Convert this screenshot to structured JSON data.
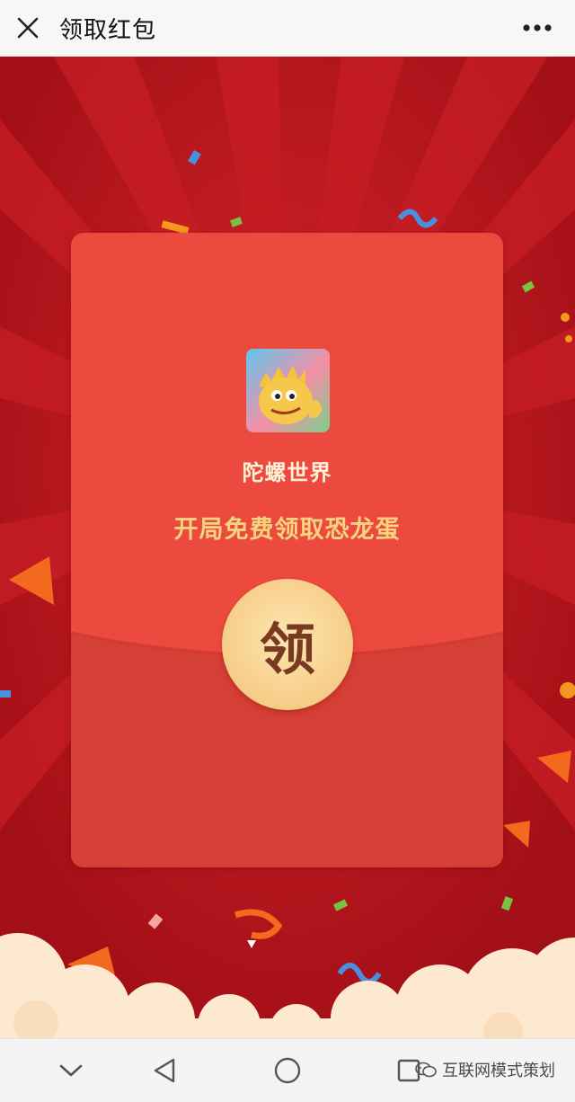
{
  "header": {
    "title": "领取红包",
    "close_icon": "close-icon",
    "more_icon": "more-dots-icon"
  },
  "envelope": {
    "app_name": "陀螺世界",
    "promo_text": "开局免费领取恐龙蛋",
    "claim_label": "领",
    "logo_icon": "dinosaur-logo-icon"
  },
  "nav": {
    "items": [
      "chevron-down-icon",
      "back-triangle-icon",
      "home-circle-icon",
      "recents-square-icon"
    ]
  },
  "watermark": {
    "text": "互联网模式策划",
    "icon": "wechat-channel-icon"
  },
  "colors": {
    "background_red": "#b5121b",
    "envelope_red": "#ec4a3e",
    "gold_text": "#f6d37e",
    "button_gold": "#f6cc86"
  }
}
